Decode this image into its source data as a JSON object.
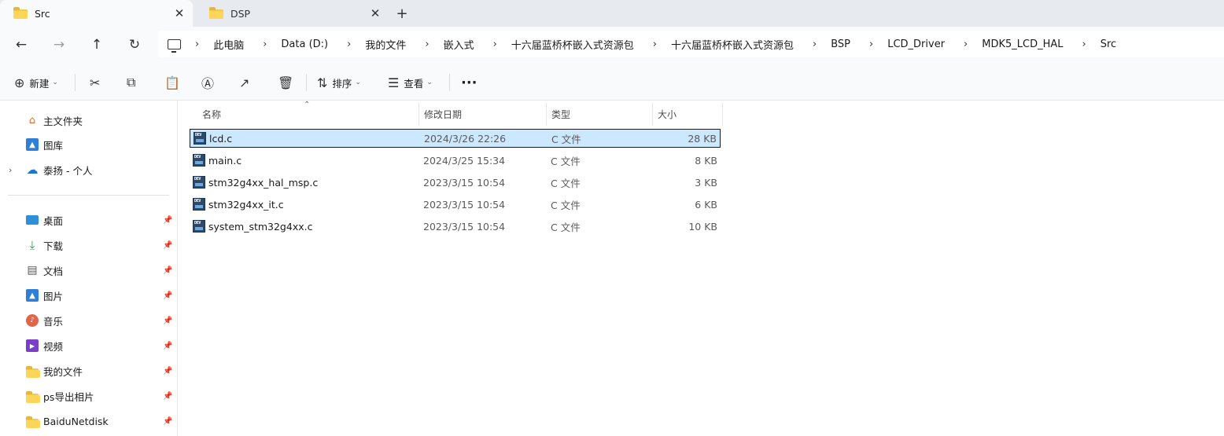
{
  "tabs": [
    {
      "label": "Src",
      "active": true
    },
    {
      "label": "DSP",
      "active": false
    }
  ],
  "tab_close_glyph": "✕",
  "new_tab_glyph": "+",
  "nav": {
    "back": "←",
    "forward": "→",
    "up": "↑",
    "refresh": "↻"
  },
  "breadcrumb": [
    "此电脑",
    "Data (D:)",
    "我的文件",
    "嵌入式",
    "十六届蓝桥杯嵌入式资源包",
    "十六届蓝桥杯嵌入式资源包",
    "BSP",
    "LCD_Driver",
    "MDK5_LCD_HAL",
    "Src"
  ],
  "toolbar": {
    "new_label": "新建",
    "sort_label": "排序",
    "view_label": "查看",
    "more": "···"
  },
  "sidebar": {
    "top_items": [
      {
        "label": "主文件夹",
        "icon": "home-icon"
      },
      {
        "label": "图库",
        "icon": "gallery-icon"
      },
      {
        "label": "泰扬 - 个人",
        "icon": "onedrive-icon"
      }
    ],
    "pinned_items": [
      {
        "label": "桌面",
        "icon": "desktop-icon"
      },
      {
        "label": "下载",
        "icon": "download-icon"
      },
      {
        "label": "文档",
        "icon": "document-icon"
      },
      {
        "label": "图片",
        "icon": "pictures-icon"
      },
      {
        "label": "音乐",
        "icon": "music-icon"
      },
      {
        "label": "视频",
        "icon": "video-icon"
      },
      {
        "label": "我的文件",
        "icon": "folder-icon"
      },
      {
        "label": "ps导出相片",
        "icon": "folder-icon"
      },
      {
        "label": "BaiduNetdisk",
        "icon": "folder-icon"
      }
    ]
  },
  "columns": {
    "name": "名称",
    "date": "修改日期",
    "type": "类型",
    "size": "大小"
  },
  "files": [
    {
      "name": "lcd.c",
      "date": "2024/3/26 22:26",
      "type": "C 文件",
      "size": "28 KB",
      "selected": true
    },
    {
      "name": "main.c",
      "date": "2024/3/25 15:34",
      "type": "C 文件",
      "size": "8 KB",
      "selected": false
    },
    {
      "name": "stm32g4xx_hal_msp.c",
      "date": "2023/3/15 10:54",
      "type": "C 文件",
      "size": "3 KB",
      "selected": false
    },
    {
      "name": "stm32g4xx_it.c",
      "date": "2023/3/15 10:54",
      "type": "C 文件",
      "size": "6 KB",
      "selected": false
    },
    {
      "name": "system_stm32g4xx.c",
      "date": "2023/3/15 10:54",
      "type": "C 文件",
      "size": "10 KB",
      "selected": false
    }
  ],
  "colors": {
    "selection": "#cce8ff",
    "folder": "#fcd55a",
    "tabbar": "#e7ebf0"
  }
}
